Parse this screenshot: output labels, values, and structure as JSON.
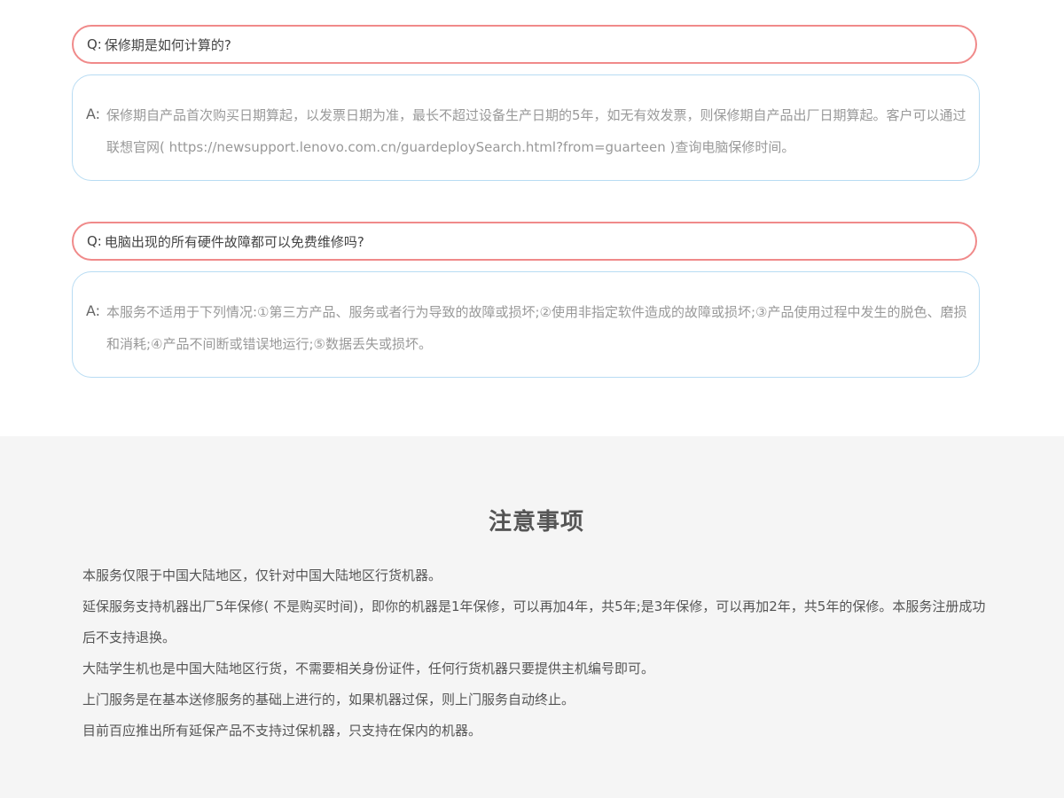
{
  "faq": [
    {
      "q_prefix": "Q:",
      "question": "保修期是如何计算的?",
      "a_prefix": "A:",
      "answer": "保修期自产品首次购买日期算起，以发票日期为准，最长不超过设备生产日期的5年，如无有效发票，则保修期自产品出厂日期算起。客户可以通过联想官网( https://newsupport.lenovo.com.cn/guardeploySearch.html?from=guarteen )查询电脑保修时间。"
    },
    {
      "q_prefix": "Q:",
      "question": "电脑出现的所有硬件故障都可以免费维修吗?",
      "a_prefix": "A:",
      "answer": "本服务不适用于下列情况:①第三方产品、服务或者行为导致的故障或损坏;②使用非指定软件造成的故障或损坏;③产品使用过程中发生的脱色、磨损和消耗;④产品不间断或错误地运行;⑤数据丢失或损坏。"
    }
  ],
  "notes": {
    "title": "注意事项",
    "items": [
      "本服务仅限于中国大陆地区，仅针对中国大陆地区行货机器。",
      "延保服务支持机器出厂5年保修( 不是购买时间)，即你的机器是1年保修，可以再加4年，共5年;是3年保修，可以再加2年，共5年的保修。本服务注册成功后不支持退换。",
      "大陆学生机也是中国大陆地区行货，不需要相关身份证件，任何行货机器只要提供主机编号即可。",
      "上门服务是在基本送修服务的基础上进行的，如果机器过保，则上门服务自动终止。",
      "目前百应推出所有延保产品不支持过保机器，只支持在保内的机器。"
    ]
  },
  "colors": {
    "question_border": "#f08a8a",
    "answer_border": "#b8dcf3",
    "notes_background": "#f5f5f5"
  }
}
